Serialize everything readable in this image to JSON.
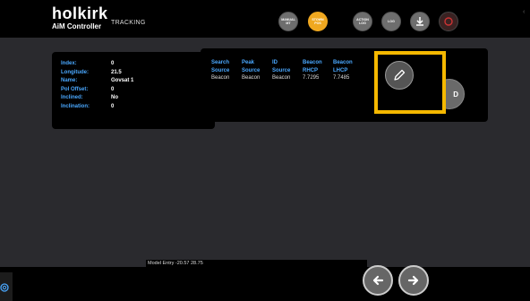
{
  "header": {
    "brand": "holkirk",
    "subtitle": "AiM Controller",
    "page_name": "TRACKING",
    "buttons": [
      {
        "label": "MANUAL MT",
        "style": "gray"
      },
      {
        "label": "STOWN POS",
        "style": "orange"
      },
      {
        "label": "ACTION LOG",
        "style": "gray"
      },
      {
        "label": "LOG",
        "style": "gray"
      }
    ]
  },
  "satellite_info": [
    {
      "key": "Index:",
      "value": "0"
    },
    {
      "key": "Longitude:",
      "value": "21.5"
    },
    {
      "key": "Name:",
      "value": "Govsat 1"
    },
    {
      "key": "Pol Offset:",
      "value": "0"
    },
    {
      "key": "Inclined:",
      "value": "No"
    },
    {
      "key": "Inclination:",
      "value": "0"
    }
  ],
  "source_table": {
    "columns": [
      {
        "h1": "Search",
        "h2": "Source",
        "cell": "Beacon"
      },
      {
        "h1": "Peak",
        "h2": "Source",
        "cell": "Beacon"
      },
      {
        "h1": "ID",
        "h2": "Source",
        "cell": "Beacon"
      },
      {
        "h1": "Beacon",
        "h2": "RHCP",
        "cell": "7.7295"
      },
      {
        "h1": "Beacon",
        "h2": "LHCP",
        "cell": "7.7485"
      }
    ]
  },
  "model_entry": "Model Entry -20.57 28.75",
  "colors": {
    "accent": "#4aa8ff",
    "highlight": "#f5b800",
    "orange": "#f0a820"
  },
  "icons": {
    "edit": "pencil-icon",
    "prev": "arrow-left-icon",
    "next": "arrow-right-icon",
    "settings": "gear-icon",
    "download": "download-icon"
  }
}
